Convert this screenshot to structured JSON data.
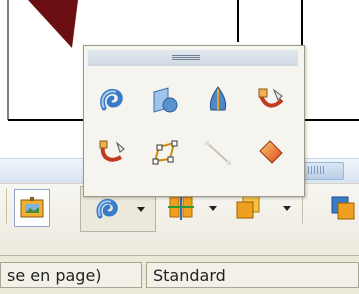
{
  "status_bar": {
    "page_style_partial": "se en page)",
    "style_name": "Standard"
  },
  "palette": {
    "buttons": [
      {
        "icon": "blue-curved-arrow-icon"
      },
      {
        "icon": "shape-with-circle-icon"
      },
      {
        "icon": "blue-teardrop-icon"
      },
      {
        "icon": "red-curve-hand-icon"
      },
      {
        "icon": "red-hook-curve-icon"
      },
      {
        "icon": "orange-polygon-icon"
      },
      {
        "icon": "disabled-line-icon"
      },
      {
        "icon": "orange-gradient-icon"
      }
    ]
  },
  "toolbar": {
    "buttons": [
      {
        "icon": "picture-frame-icon"
      },
      {
        "icon": "blue-curved-arrow-icon"
      },
      {
        "icon": "align-icon"
      },
      {
        "icon": "orange-square-icon"
      },
      {
        "icon": "partial-shape-icon"
      }
    ]
  },
  "colors": {
    "accent_orange": "#f0a020",
    "accent_blue": "#3a7bc8",
    "arrow_dark_red": "#6b0f12"
  }
}
